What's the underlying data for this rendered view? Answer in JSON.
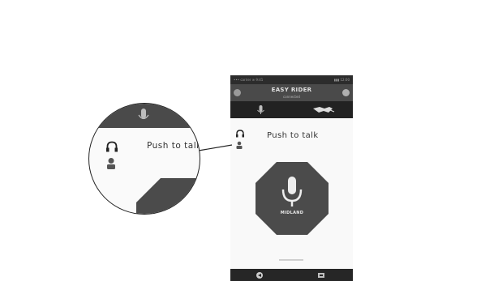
{
  "callout": {
    "label": "Push to talk"
  },
  "app": {
    "status_left": "••• carrier ≋ 9:41",
    "status_right": "▮▮▮ 12:00",
    "header_title": "EASY RIDER",
    "header_subtitle": "connected",
    "tabs": [
      {
        "icon": "microphone-icon"
      },
      {
        "icon": "handshake-icon"
      }
    ],
    "push_label": "Push to talk",
    "icons": [
      "headphones-icon",
      "person-icon"
    ],
    "brand": "MIDLAND",
    "bottom_icons": [
      "back-icon",
      "settings-icon"
    ]
  },
  "colors": {
    "header": "#4a4a4a",
    "tab_bar": "#222222",
    "octagon": "#4b4b4b",
    "background": "#ffffff"
  }
}
